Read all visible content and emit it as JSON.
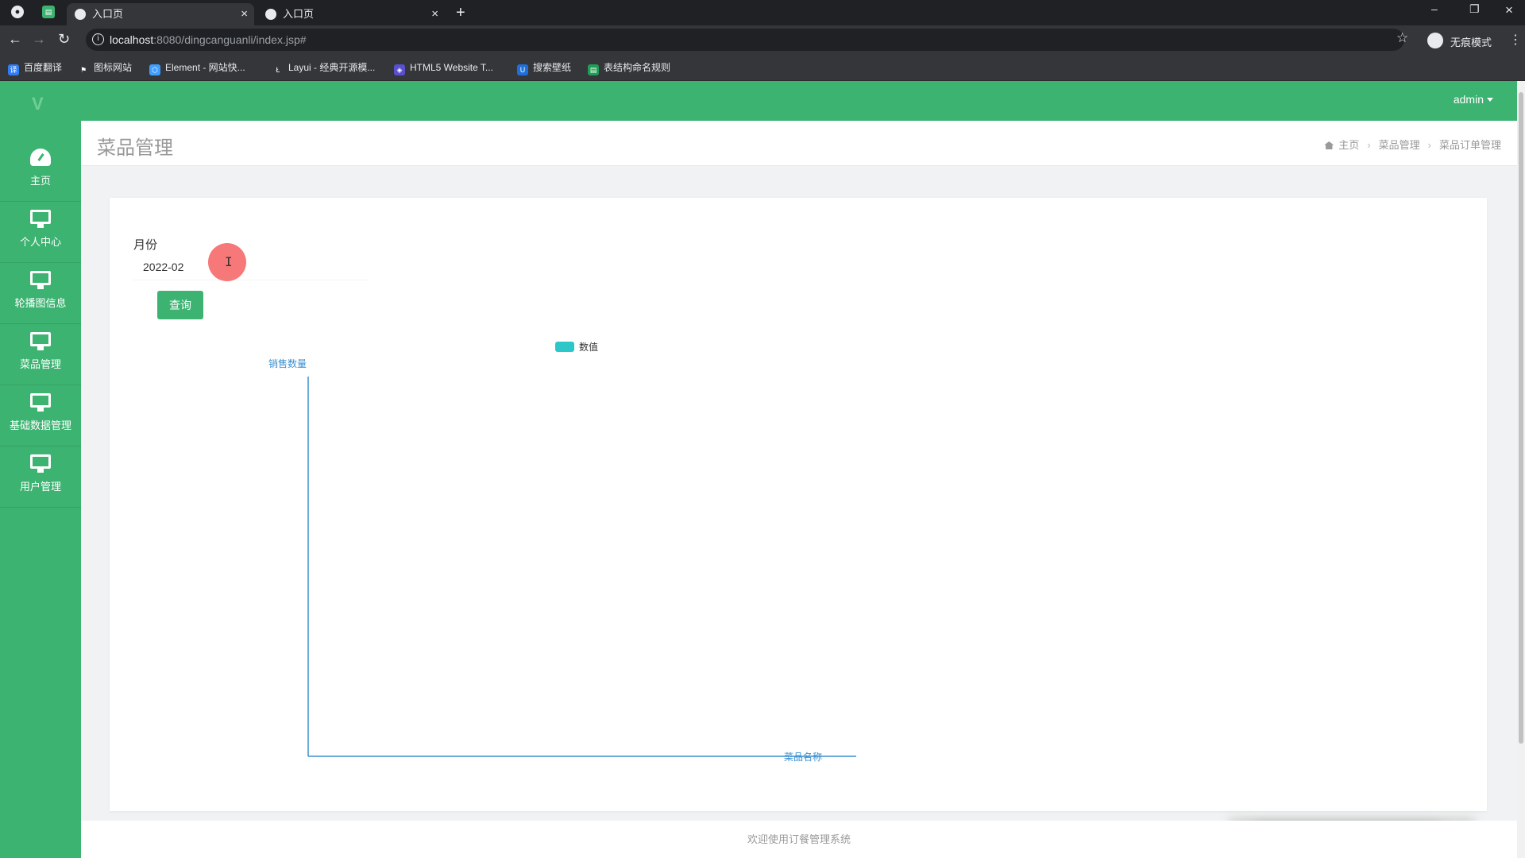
{
  "browser": {
    "tabs": [
      {
        "label": "入口页",
        "active": true
      },
      {
        "label": "入口页",
        "active": false
      }
    ],
    "url_host": "localhost",
    "url_path": ":8080/dingcanguanli/index.jsp#",
    "incognito_label": "无痕模式",
    "bookmarks": [
      {
        "label": "百度翻译",
        "icon": "translate-icon",
        "color": "#2f7cf6",
        "glyph": "译"
      },
      {
        "label": "图标网站",
        "icon": "flag-icon",
        "color": "#35363a",
        "glyph": "⚑"
      },
      {
        "label": "Element - 网站快...",
        "icon": "element-icon",
        "color": "#409eff",
        "glyph": "⬡"
      },
      {
        "label": "Layui - 经典开源模...",
        "icon": "layui-icon",
        "color": "#35363a",
        "glyph": "Ł"
      },
      {
        "label": "HTML5 Website T...",
        "icon": "html5-icon",
        "color": "#5a4fcf",
        "glyph": "◈"
      },
      {
        "label": "搜索壁纸",
        "icon": "wallpaper-icon",
        "color": "#1e6fd9",
        "glyph": "U"
      },
      {
        "label": "表结构命名规则",
        "icon": "sheet-icon",
        "color": "#1e9e55",
        "glyph": "▤"
      }
    ]
  },
  "sidebar": {
    "logo_glyph": "V",
    "items": [
      {
        "label": "主页",
        "icon": "dashboard-icon"
      },
      {
        "label": "个人中心",
        "icon": "monitor-icon"
      },
      {
        "label": "轮播图信息",
        "icon": "monitor-icon"
      },
      {
        "label": "菜品管理",
        "icon": "monitor-icon"
      },
      {
        "label": "基础数据管理",
        "icon": "monitor-icon"
      },
      {
        "label": "用户管理",
        "icon": "monitor-icon"
      }
    ]
  },
  "topbar": {
    "user": "admin"
  },
  "header": {
    "title": "菜品管理",
    "breadcrumb": [
      "主页",
      "菜品管理",
      "菜品订单管理"
    ]
  },
  "form": {
    "month_label": "月份",
    "month_value": "2022-02",
    "query_label": "查询"
  },
  "chart_data": {
    "type": "bar",
    "categories": [],
    "series": [
      {
        "name": "数值",
        "values": []
      }
    ],
    "ylabel": "销售数量",
    "xlabel": "菜品名称",
    "legend_color": "#2ec7c9",
    "axis_color": "#3a8fd1"
  },
  "footer": {
    "text": "欢迎使用订餐管理系统"
  },
  "colors": {
    "brand": "#3cb371"
  }
}
